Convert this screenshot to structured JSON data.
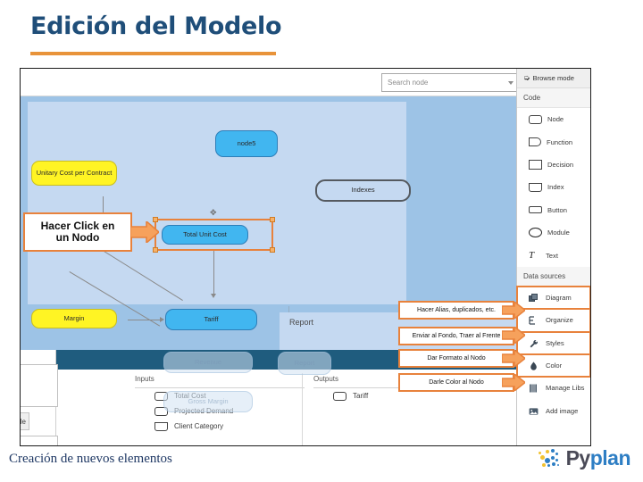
{
  "slide": {
    "title": "Edición del Modelo",
    "footer": "Creación de nuevos elementos",
    "accent_color": "#E8933A",
    "title_color": "#1F4E79"
  },
  "brand": {
    "name_part1": "Py",
    "name_part2": "plan",
    "mark_icon": "dotted-circle-icon",
    "color_dark": "#4A4A57",
    "color_blue": "#2E7EC4",
    "color_yellow": "#F2C230"
  },
  "app": {
    "toolbar": {
      "search": {
        "placeholder": "Search node",
        "value": "",
        "caret_icon": "chevron-down-icon"
      }
    },
    "sidebar": {
      "browse_mode": {
        "label": "Browse mode",
        "icon": "cursor-icon"
      },
      "groups": [
        {
          "label": "Code",
          "items": [
            {
              "label": "Node",
              "icon": "node-shape-icon",
              "highlight": false
            },
            {
              "label": "Function",
              "icon": "function-shape-icon",
              "highlight": false
            },
            {
              "label": "Decision",
              "icon": "decision-shape-icon",
              "highlight": false
            },
            {
              "label": "Index",
              "icon": "index-shape-icon",
              "highlight": false
            },
            {
              "label": "Button",
              "icon": "button-shape-icon",
              "highlight": false
            },
            {
              "label": "Module",
              "icon": "module-shape-icon",
              "highlight": false
            },
            {
              "label": "Text",
              "icon": "text-icon",
              "highlight": false
            }
          ]
        },
        {
          "label": "Data sources",
          "items": [
            {
              "label": "Diagram",
              "icon": "diagram-icon",
              "highlight": true
            },
            {
              "label": "Organize",
              "icon": "organize-icon",
              "highlight": true
            },
            {
              "label": "Styles",
              "icon": "styles-wrench-icon",
              "highlight": true
            },
            {
              "label": "Color",
              "icon": "color-drop-icon",
              "highlight": true
            },
            {
              "label": "Manage Libs",
              "icon": "library-icon",
              "highlight": false
            },
            {
              "label": "Add image",
              "icon": "image-icon",
              "highlight": false
            }
          ]
        }
      ]
    },
    "canvas": {
      "zone_label": "Report",
      "nodes": [
        {
          "id": "node5",
          "label": "node5",
          "style": "blue"
        },
        {
          "id": "unitary",
          "label": "Unitary Cost per Contract",
          "style": "yellow"
        },
        {
          "id": "indexes",
          "label": "Indexes",
          "style": "index"
        },
        {
          "id": "totaluc",
          "label": "Total Unit Cost",
          "style": "blue",
          "selected": true
        },
        {
          "id": "margin",
          "label": "Margin",
          "style": "yellow"
        },
        {
          "id": "tariff",
          "label": "Tariff",
          "style": "blue"
        },
        {
          "id": "revenue",
          "label": "Revenue",
          "style": "ghost"
        },
        {
          "id": "grossm",
          "label": "Gross Margin",
          "style": "ghost"
        },
        {
          "id": "reportgh",
          "label": "Report",
          "style": "ghost"
        }
      ]
    },
    "io_panel": {
      "inputs": {
        "header": "Inputs",
        "items": [
          {
            "label": "Total Cost",
            "icon": "node-shape-icon"
          },
          {
            "label": "Projected Demand",
            "icon": "node-shape-icon"
          },
          {
            "label": "Client Category",
            "icon": "index-shape-icon"
          }
        ]
      },
      "outputs": {
        "header": "Outputs",
        "items": [
          {
            "label": "Tariff",
            "icon": "node-shape-icon"
          }
        ]
      },
      "left_stub_label": "le"
    }
  },
  "annotations": {
    "accent_color": "#E8823C",
    "callouts": [
      {
        "id": "click-node",
        "text_line1": "Hacer Click en",
        "text_line2": "un Nodo",
        "target": "totaluc"
      },
      {
        "id": "alias",
        "text": "Hacer Alias, duplicados, etc.",
        "target": "Diagram"
      },
      {
        "id": "zorder",
        "text": "Enviar al Fondo, Traer al Frente",
        "target": "Organize"
      },
      {
        "id": "format",
        "text": "Dar Formato al Nodo",
        "target": "Styles"
      },
      {
        "id": "color",
        "text": "Darle Color al Nodo",
        "target": "Color"
      }
    ]
  }
}
